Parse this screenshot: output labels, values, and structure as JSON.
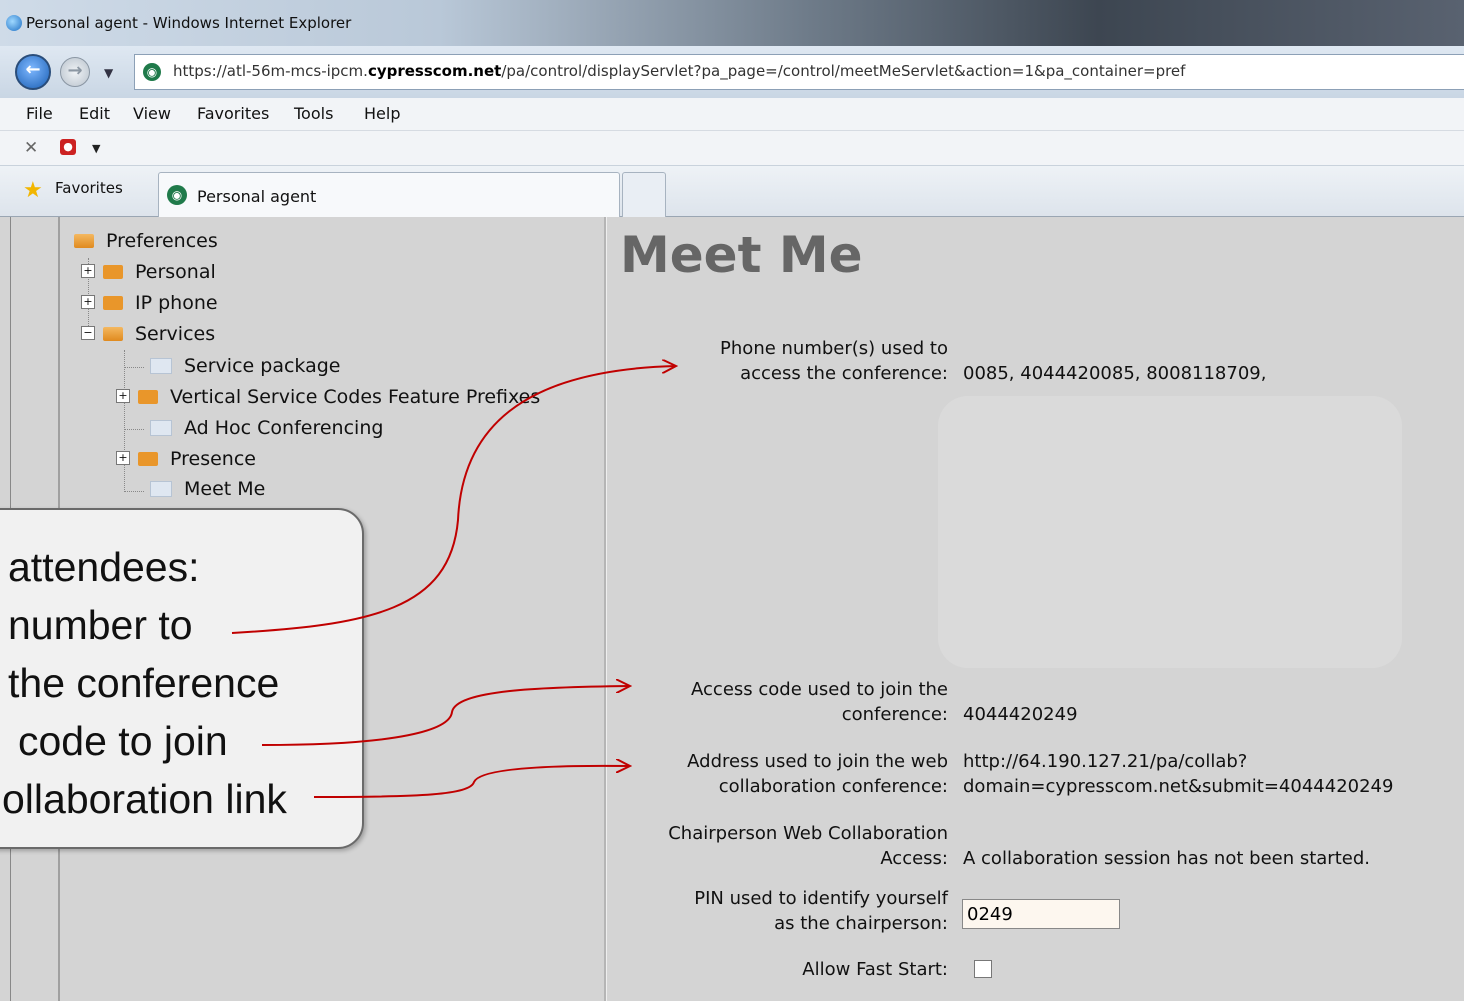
{
  "window": {
    "title": "Personal agent - Windows Internet Explorer"
  },
  "address_bar": {
    "url_prefix": "https://atl-56m-mcs-ipcm.",
    "url_domain": "cypresscom.net",
    "url_suffix": "/pa/control/displayServlet?pa_page=/control/meetMeServlet&action=1&pa_container=pref"
  },
  "menu": {
    "items": [
      "File",
      "Edit",
      "View",
      "Favorites",
      "Tools",
      "Help"
    ]
  },
  "favorites": {
    "label": "Favorites"
  },
  "tabs": {
    "active_label": "Personal agent"
  },
  "tree": {
    "root": "Preferences",
    "items": [
      "Personal",
      "IP phone",
      "Services"
    ],
    "services_children": [
      "Service package",
      "Vertical Service Codes Feature Prefixes",
      "Ad Hoc Conferencing",
      "Presence",
      "Meet Me"
    ]
  },
  "main": {
    "title": "Meet Me",
    "phone": {
      "label_line1": "Phone number(s) used to",
      "label_line2": "access the conference:",
      "value": "0085, 4044420085, 8008118709,"
    },
    "access_code": {
      "label_line1": "Access code used to join the",
      "label_line2": "conference:",
      "value": "4044420249"
    },
    "web_address": {
      "label_line1": "Address used to join the web",
      "label_line2": "collaboration conference:",
      "value_line1": "http://64.190.127.21/pa/collab?",
      "value_line2": "domain=cypresscom.net&submit=4044420249"
    },
    "chair_access": {
      "label_line1": "Chairperson Web Collaboration",
      "label_line2": "Access:",
      "value": "A collaboration session has not been started."
    },
    "pin": {
      "label_line1": "PIN used to identify yourself",
      "label_line2": "as the chairperson:",
      "value": "0249"
    },
    "fast_start": {
      "label": "Allow Fast Start:",
      "checked": false
    }
  },
  "callout": {
    "lines": [
      "attendees:",
      "number to",
      "the conference",
      "code to join",
      "ollaboration link"
    ]
  },
  "colors": {
    "arrow": "#c00000",
    "title_gray": "#666666",
    "icon_green": "#1f7a4a"
  }
}
